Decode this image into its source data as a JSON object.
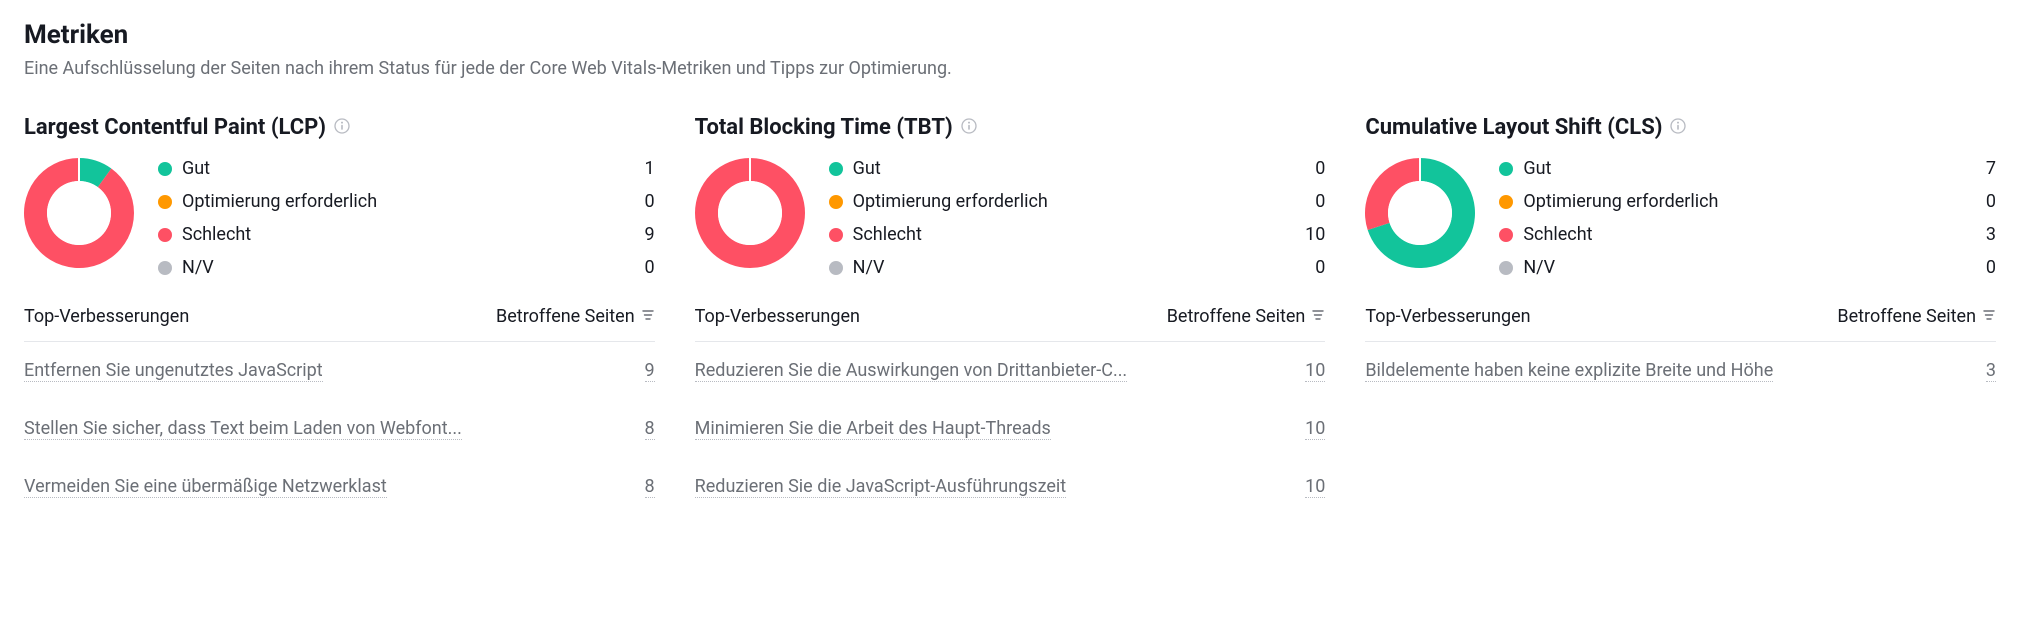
{
  "header": {
    "title": "Metriken",
    "subtitle": "Eine Aufschlüsselung der Seiten nach ihrem Status für jede der Core Web Vitals-Metriken und Tipps zur Optimierung."
  },
  "status_labels": {
    "good": "Gut",
    "needs": "Optimierung erforderlich",
    "bad": "Schlecht",
    "nv": "N/V"
  },
  "colors": {
    "good": "#12c49b",
    "needs": "#ff9800",
    "bad": "#fe5064",
    "nv": "#b8bbc2"
  },
  "table_header": {
    "improvements": "Top-Verbesserungen",
    "affected": "Betroffene Seiten"
  },
  "metrics": [
    {
      "title": "Largest Contentful Paint (LCP)",
      "counts": {
        "good": 1,
        "needs": 0,
        "bad": 9,
        "nv": 0
      },
      "improvements": [
        {
          "text": "Entfernen Sie ungenutztes JavaScript",
          "count": 9
        },
        {
          "text": "Stellen Sie sicher, dass Text beim Laden von Webfont...",
          "count": 8
        },
        {
          "text": "Vermeiden Sie eine übermäßige Netzwerklast",
          "count": 8
        }
      ]
    },
    {
      "title": "Total Blocking Time (TBT)",
      "counts": {
        "good": 0,
        "needs": 0,
        "bad": 10,
        "nv": 0
      },
      "improvements": [
        {
          "text": "Reduzieren Sie die Auswirkungen von Drittanbieter-C...",
          "count": 10
        },
        {
          "text": "Minimieren Sie die Arbeit des Haupt-Threads",
          "count": 10
        },
        {
          "text": "Reduzieren Sie die JavaScript-Ausführungszeit",
          "count": 10
        }
      ]
    },
    {
      "title": "Cumulative Layout Shift (CLS)",
      "counts": {
        "good": 7,
        "needs": 0,
        "bad": 3,
        "nv": 0
      },
      "improvements": [
        {
          "text": "Bildelemente haben keine explizite Breite und Höhe",
          "count": 3
        }
      ]
    }
  ],
  "chart_data": [
    {
      "type": "pie",
      "title": "Largest Contentful Paint (LCP)",
      "categories": [
        "Gut",
        "Optimierung erforderlich",
        "Schlecht",
        "N/V"
      ],
      "values": [
        1,
        0,
        9,
        0
      ]
    },
    {
      "type": "pie",
      "title": "Total Blocking Time (TBT)",
      "categories": [
        "Gut",
        "Optimierung erforderlich",
        "Schlecht",
        "N/V"
      ],
      "values": [
        0,
        0,
        10,
        0
      ]
    },
    {
      "type": "pie",
      "title": "Cumulative Layout Shift (CLS)",
      "categories": [
        "Gut",
        "Optimierung erforderlich",
        "Schlecht",
        "N/V"
      ],
      "values": [
        7,
        0,
        3,
        0
      ]
    }
  ]
}
